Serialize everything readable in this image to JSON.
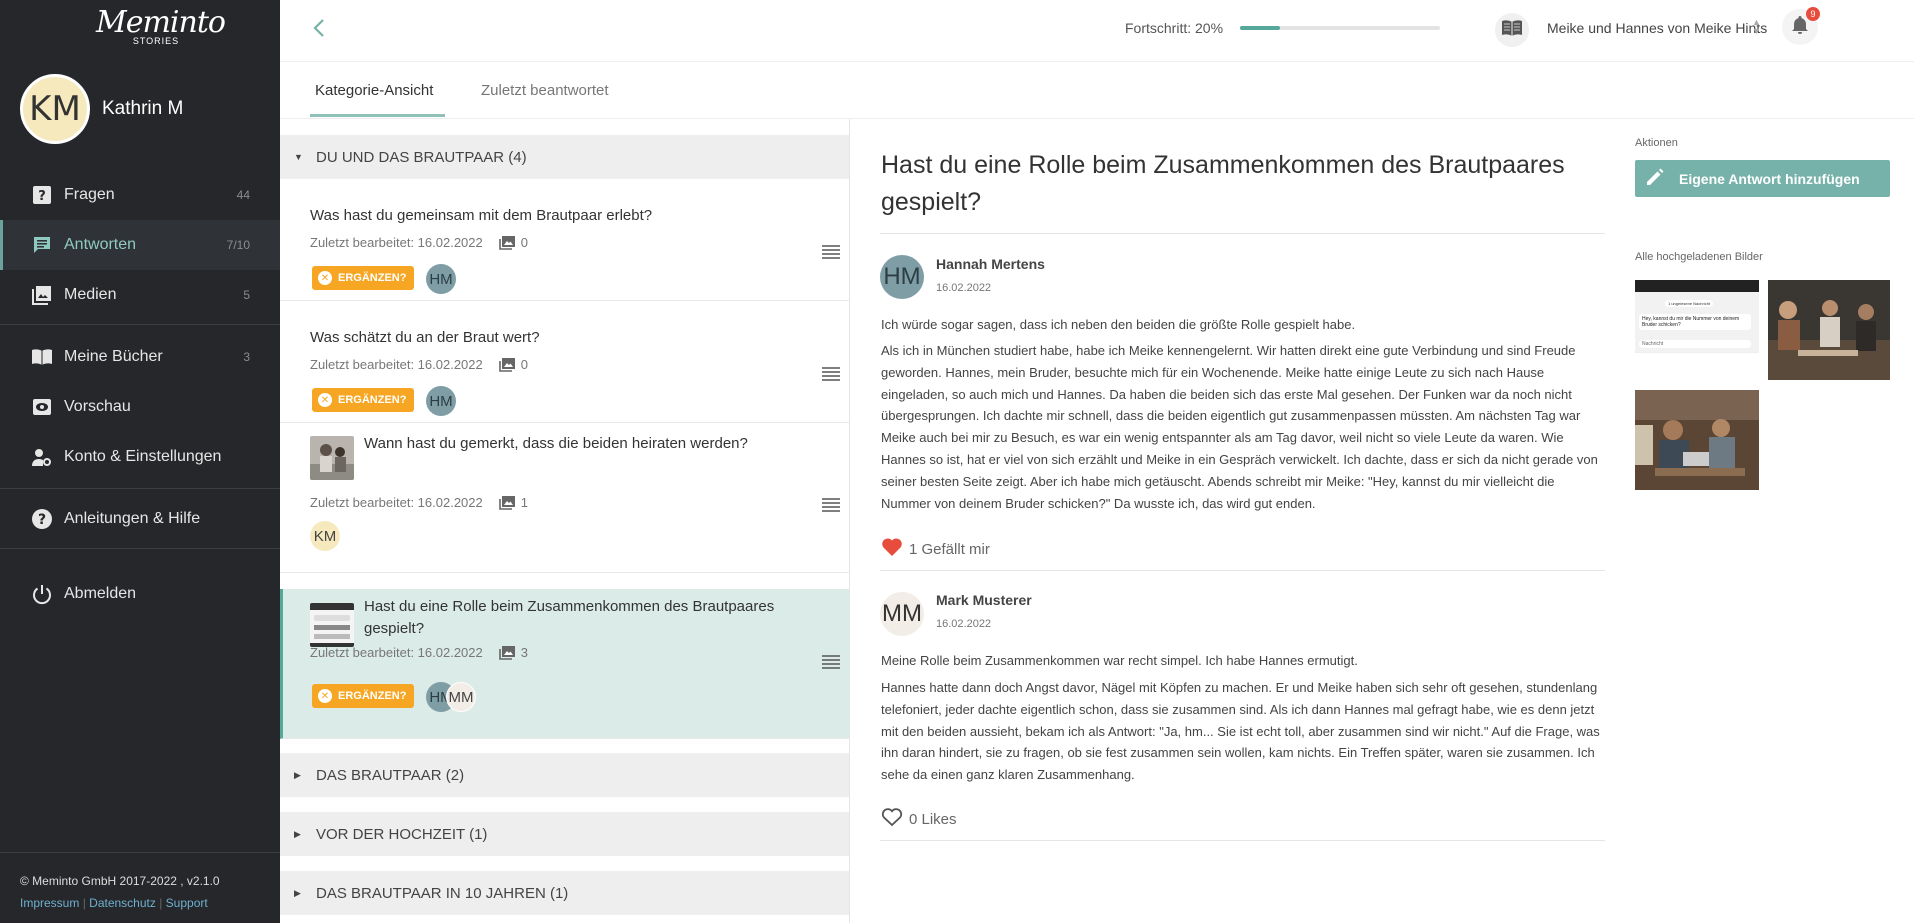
{
  "brand": {
    "logo_main": "Meminto",
    "logo_sub": "STORIES"
  },
  "user": {
    "initials": "KM",
    "name": "Kathrin M"
  },
  "nav": [
    {
      "label": "Fragen",
      "count": "44",
      "icon": "question-icon"
    },
    {
      "label": "Antworten",
      "count": "7/10",
      "icon": "answers-icon",
      "active": true
    },
    {
      "label": "Medien",
      "count": "5",
      "icon": "image-icon"
    },
    {
      "label": "Meine Bücher",
      "count": "3",
      "icon": "book-icon"
    },
    {
      "label": "Vorschau",
      "count": "",
      "icon": "eye-icon"
    },
    {
      "label": "Konto & Einstellungen",
      "count": "",
      "icon": "user-settings-icon"
    },
    {
      "label": "Anleitungen & Hilfe",
      "count": "",
      "icon": "help-icon"
    },
    {
      "label": "Abmelden",
      "count": "",
      "icon": "power-icon"
    }
  ],
  "footer": {
    "copyright": "© Meminto GmbH 2017-2022 , v2.1.0",
    "impressum": "Impressum",
    "datenschutz": "Datenschutz",
    "support": "Support"
  },
  "topbar": {
    "progress_label": "Fortschritt: 20%",
    "progress": 0.2,
    "book_title": "Meike und Hannes von Meike Hints",
    "notifications": "9"
  },
  "tabs": {
    "category": "Kategorie-Ansicht",
    "recent": "Zuletzt beantwortet"
  },
  "categories": [
    "DU UND DAS BRAUTPAAR (4)",
    "DAS BRAUTPAAR (2)",
    "VOR DER HOCHZEIT (1)",
    "DAS BRAUTPAAR IN 10 JAHREN (1)"
  ],
  "questions": [
    {
      "title": "Was hast du gemeinsam mit dem Brautpaar erlebt?",
      "edited": "Zuletzt bearbeitet: 16.02.2022",
      "images": "0",
      "pill": "ERGÄNZEN?",
      "avatars": [
        "HM"
      ]
    },
    {
      "title": "Was schätzt du an der Braut wert?",
      "edited": "Zuletzt bearbeitet: 16.02.2022",
      "images": "0",
      "pill": "ERGÄNZEN?",
      "avatars": [
        "HM"
      ]
    },
    {
      "title": "Wann hast du gemerkt, dass die beiden heiraten werden?",
      "edited": "Zuletzt bearbeitet: 16.02.2022",
      "images": "1",
      "pill": "",
      "avatars": [
        "KM"
      ]
    },
    {
      "title": "Hast du eine Rolle beim Zusammenkommen des Brautpaares gespielt?",
      "edited": "Zuletzt bearbeitet: 16.02.2022",
      "images": "3",
      "pill": "ERGÄNZEN?",
      "avatars": [
        "HM",
        "MM"
      ]
    }
  ],
  "detail": {
    "title": "Hast du eine Rolle beim Zusammenkommen des Brautpaares gespielt?",
    "answers": [
      {
        "initials": "HM",
        "name": "Hannah Mertens",
        "date": "16.02.2022",
        "p1": "Ich würde sogar sagen, dass ich neben den beiden die größte Rolle gespielt habe.",
        "p2": "Als ich in München studiert habe, habe ich Meike kennengelernt. Wir hatten direkt eine gute Verbindung und sind Freude geworden. Hannes, mein Bruder, besuchte mich für ein Wochenende. Meike hatte einige Leute zu sich nach Hause eingeladen, so auch mich und Hannes. Da haben die beiden sich das erste Mal gesehen. Der Funken war da noch nicht übergesprungen. Ich dachte mir schnell, dass die beiden eigentlich gut zusammenpassen müssten. Am nächsten Tag war Meike auch bei mir zu Besuch, es war ein wenig entspannter als am Tag davor, weil nicht so viele Leute da waren. Wie Hannes so ist, hat er viel von sich erzählt und Meike in ein Gespräch verwickelt. Ich dachte, dass er sich da nicht gerade von seiner besten Seite zeigt. Aber ich habe mich getäuscht. Abends schreibt mir Meike: \"Hey, kannst du mir vielleicht die Nummer von deinem Bruder schicken?\" Da wusste ich, das wird gut enden.",
        "likes": "1 Gefällt mir"
      },
      {
        "initials": "MM",
        "name": "Mark Musterer",
        "date": "16.02.2022",
        "p1": "Meine Rolle beim Zusammenkommen war recht simpel. Ich habe Hannes ermutigt.",
        "p2": "Hannes hatte dann doch Angst davor, Nägel mit Köpfen zu machen. Er und Meike haben sich sehr oft gesehen, stundenlang telefoniert, jeder dachte eigentlich schon, dass sie zusammen sind. Als ich dann Hannes mal gefragt habe, wie es denn jetzt mit den beiden aussieht, bekam ich als Antwort: \"Ja, hm... Sie ist echt toll, aber zusammen sind wir nicht.\" Auf die Frage, was ihn daran hindert, sie zu fragen, ob sie fest zusammen sein wollen, kam nichts. Ein Treffen später, waren sie zusammen. Ich sehe da einen ganz klaren Zusammenhang.",
        "likes": "0 Likes"
      }
    ]
  },
  "side": {
    "actions_label": "Aktionen",
    "add_button": "Eigene Antwort hinzufügen",
    "images_label": "Alle hochgeladenen Bilder",
    "chat_header": "1 ungelesene Nachricht",
    "chat_text": "Hey, kannst du mir die Nummer von deinem Bruder schicken?",
    "chat_input": "Nachricht"
  },
  "colors": {
    "sidebar": "#25272a",
    "accent": "#56a89a",
    "pill": "#f6a623",
    "selected": "#dbebe8"
  }
}
